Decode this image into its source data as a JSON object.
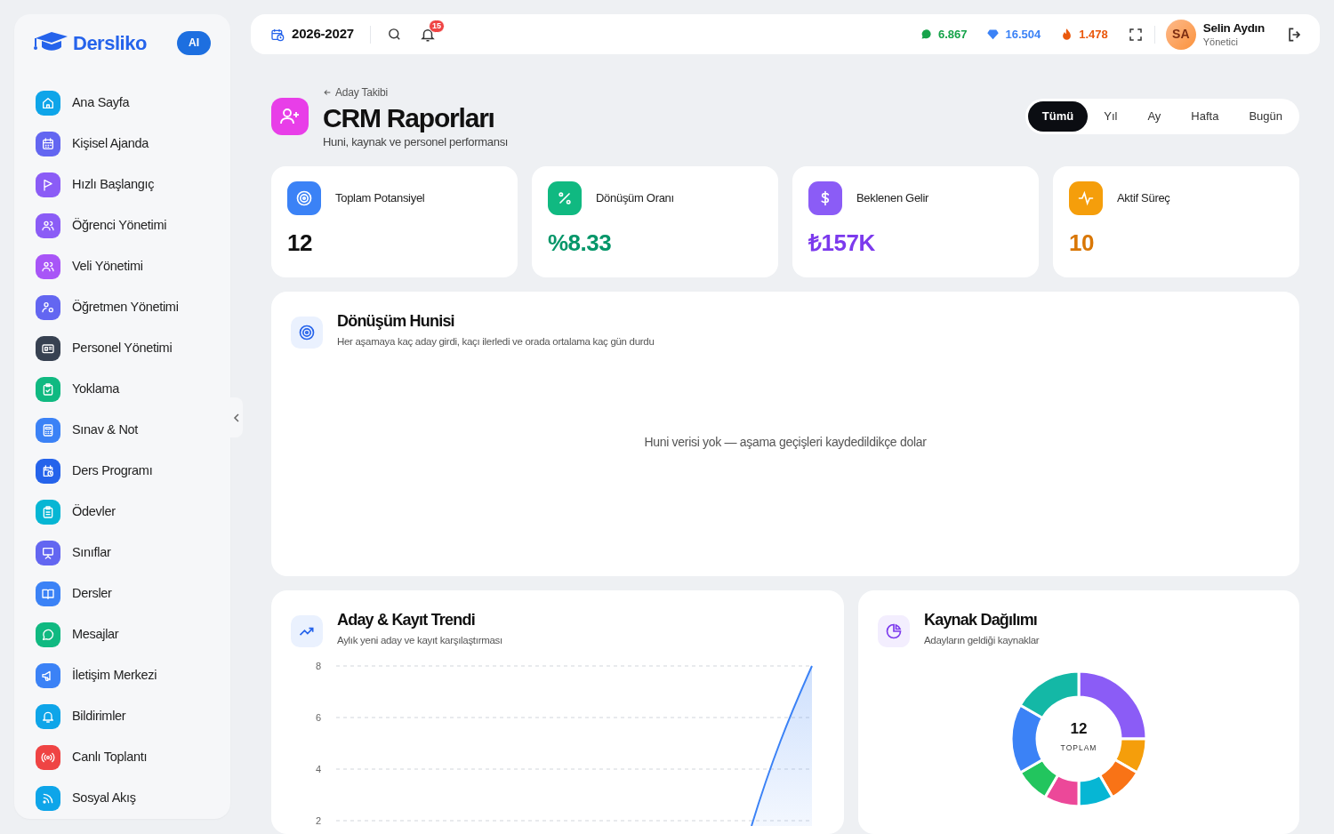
{
  "sidebar": {
    "logo": "Dersliko",
    "ai_badge": "AI",
    "items": [
      {
        "label": "Ana Sayfa",
        "selected": false
      },
      {
        "label": "Kişisel Ajanda",
        "selected": false
      },
      {
        "label": "Hızlı Başlangıç",
        "selected": false
      },
      {
        "label": "Öğrenci Yönetimi",
        "selected": false
      },
      {
        "label": "Veli Yönetimi",
        "selected": false
      },
      {
        "label": "Öğretmen Yönetimi",
        "selected": false
      },
      {
        "label": "Personel Yönetimi",
        "selected": false
      },
      {
        "label": "Yoklama",
        "selected": false
      },
      {
        "label": "Sınav & Not",
        "selected": false
      },
      {
        "label": "Ders Programı",
        "selected": false
      },
      {
        "label": "Ödevler",
        "selected": false
      },
      {
        "label": "Sınıflar",
        "selected": false
      },
      {
        "label": "Dersler",
        "selected": false
      },
      {
        "label": "Mesajlar",
        "selected": false
      },
      {
        "label": "İletişim Merkezi",
        "selected": false
      },
      {
        "label": "Bildirimler",
        "selected": false
      },
      {
        "label": "Canlı Toplantı",
        "selected": false
      },
      {
        "label": "Sosyal Akış",
        "selected": false
      }
    ]
  },
  "topbar": {
    "year": "2026-2027",
    "notification_count": "15",
    "stats": [
      {
        "value": "6.867",
        "color": "#16a34a"
      },
      {
        "value": "16.504",
        "color": "#3b82f6"
      },
      {
        "value": "1.478",
        "color": "#ea580c"
      }
    ],
    "user": {
      "initials": "SA",
      "name": "Selin Aydın",
      "role": "Yönetici"
    }
  },
  "header": {
    "back_link": "Aday Takibi",
    "title": "CRM Raporları",
    "subtitle": "Huni, kaynak ve personel performansı",
    "periods": [
      {
        "label": "Tümü",
        "selected": true
      },
      {
        "label": "Yıl",
        "selected": false
      },
      {
        "label": "Ay",
        "selected": false
      },
      {
        "label": "Hafta",
        "selected": false
      },
      {
        "label": "Bugün",
        "selected": false
      }
    ]
  },
  "kpis": [
    {
      "label": "Toplam Potansiyel",
      "value": "12",
      "color": "#111111"
    },
    {
      "label": "Dönüşüm Oranı",
      "value": "%8.33",
      "color": "#059669"
    },
    {
      "label": "Beklenen Gelir",
      "value": "₺157K",
      "color": "#7c3aed"
    },
    {
      "label": "Aktif Süreç",
      "value": "10",
      "color": "#d97706"
    }
  ],
  "funnel": {
    "title": "Dönüşüm Hunisi",
    "subtitle": "Her aşamaya kaç aday girdi, kaçı ilerledi ve orada ortalama kaç gün durdu",
    "empty_message": "Huni verisi yok — aşama geçişleri kaydedildikçe dolar"
  },
  "trend": {
    "title": "Aday & Kayıt Trendi",
    "subtitle": "Aylık yeni aday ve kayıt karşılaştırması",
    "y_axis_labels": [
      "8",
      "6",
      "4",
      "2"
    ]
  },
  "sources": {
    "title": "Kaynak Dağılımı",
    "subtitle": "Adayların geldiği kaynaklar",
    "total": "12",
    "total_label": "TOPLAM"
  }
}
